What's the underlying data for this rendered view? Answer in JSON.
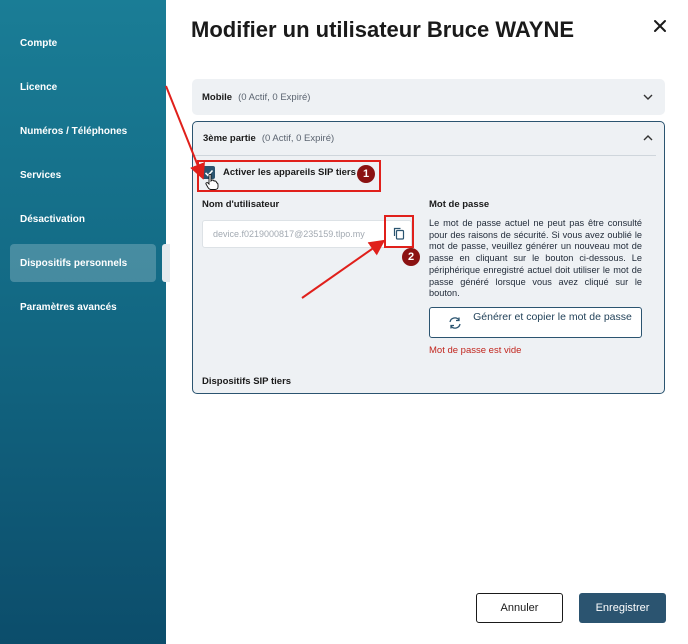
{
  "sidebar": {
    "items": [
      {
        "label": "Compte"
      },
      {
        "label": "Licence"
      },
      {
        "label": "Numéros / Téléphones"
      },
      {
        "label": "Services"
      },
      {
        "label": "Désactivation"
      },
      {
        "label": "Dispositifs personnels",
        "active": true
      },
      {
        "label": "Paramètres avancés"
      }
    ]
  },
  "header": {
    "title": "Modifier un utilisateur Bruce WAYNE",
    "close_icon": "close-icon"
  },
  "accordions": {
    "mobile": {
      "title": "Mobile",
      "count": "(0 Actif, 0 Expiré)",
      "expanded": false
    },
    "third_party": {
      "title": "3ème partie",
      "count": "(0 Actif, 0 Expiré)",
      "expanded": true,
      "sip_checkbox_label": "Activer les appareils SIP tiers",
      "sip_checkbox_checked": true,
      "username_label": "Nom d'utilisateur",
      "username_value": "device.f0219000817@235159.tlpo.my",
      "password_label": "Mot de passe",
      "password_text": "Le mot de passe actuel ne peut pas être consulté pour des raisons de sécurité. Si vous avez oublié le mot de passe, veuillez générer un nouveau mot de passe en cliquant sur le bouton ci-dessous. Le périphérique enregistré actuel doit utiliser le mot de passe généré lorsque vous avez cliqué sur le bouton.",
      "generate_button": "Générer et copier le mot de passe",
      "error_text": "Mot de passe est vide",
      "devices_label": "Dispositifs SIP tiers"
    }
  },
  "annotations": {
    "step1": "1",
    "step2": "2",
    "color": "#e0201b"
  },
  "footer": {
    "cancel_label": "Annuler",
    "save_label": "Enregistrer"
  },
  "colors": {
    "primary": "#2b5470",
    "sidebar_top": "#1a7d96",
    "sidebar_bottom": "#0c4d6b",
    "error": "#c2261e"
  }
}
